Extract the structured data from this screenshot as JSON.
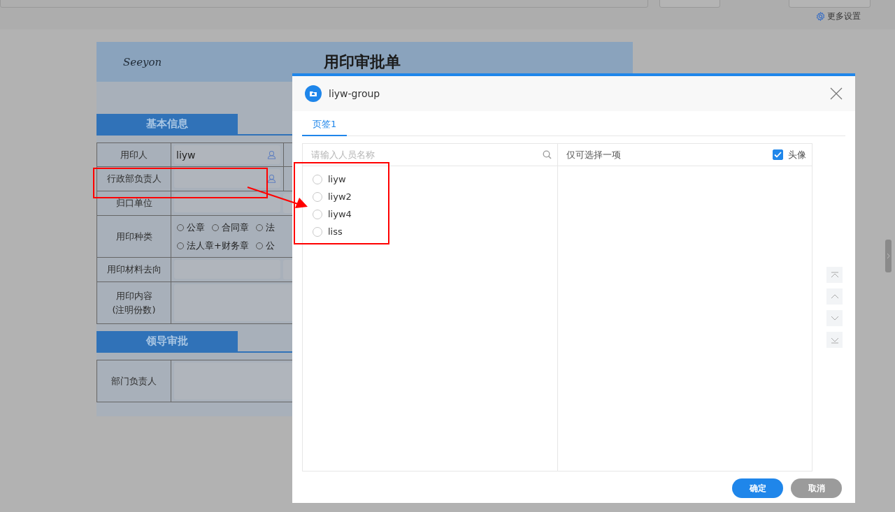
{
  "toolbar": {
    "more_settings": "更多设置"
  },
  "form": {
    "logo": "Seeyon",
    "title": "用印审批单",
    "sections": [
      {
        "title": "基本信息",
        "rows": [
          {
            "kind": "field",
            "label": "用印人",
            "value": "liyw",
            "picker": true
          },
          {
            "kind": "field",
            "label": "行政部负责人",
            "picker": true
          },
          {
            "kind": "field",
            "label": "归口单位"
          },
          {
            "kind": "radio",
            "label": "用印种类",
            "option_rows": [
              [
                {
                  "label": "公章",
                  "selected": false
                },
                {
                  "label": "合同章",
                  "selected": false
                },
                {
                  "label": "法",
                  "selected": false
                }
              ],
              [
                {
                  "label": "法人章+财务章",
                  "selected": false
                },
                {
                  "label": "公",
                  "selected": false
                }
              ]
            ]
          },
          {
            "kind": "field",
            "label": "用印材料去向"
          },
          {
            "kind": "area",
            "label": "用印内容\n(注明份数)"
          }
        ]
      },
      {
        "title": "领导审批",
        "rows": [
          {
            "kind": "area",
            "label": "部门负责人"
          }
        ]
      }
    ]
  },
  "dialog": {
    "title": "liyw-group",
    "tabs": [
      {
        "label": "页签1",
        "selected": true
      }
    ],
    "search": {
      "placeholder": "请输入人员名称"
    },
    "people": [
      {
        "name": "liyw",
        "selected": false
      },
      {
        "name": "liyw2",
        "selected": false
      },
      {
        "name": "liyw4",
        "selected": false
      },
      {
        "name": "liss",
        "selected": false
      }
    ],
    "selected_header": "仅可选择一项",
    "avatar": {
      "label": "头像",
      "checked": true
    },
    "buttons": [
      {
        "label": "确定",
        "kind": "primary"
      },
      {
        "label": "取消",
        "kind": "secondary"
      }
    ]
  }
}
